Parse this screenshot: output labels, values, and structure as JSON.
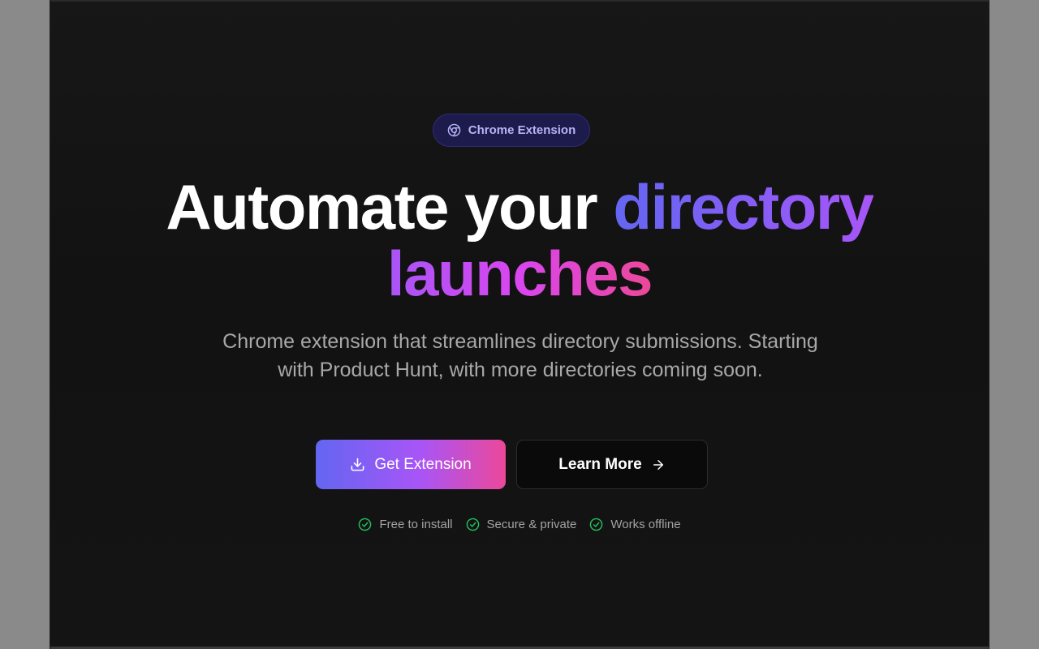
{
  "badge": {
    "label": "Chrome Extension",
    "icon": "chrome-icon"
  },
  "headline": {
    "part1": "Automate your ",
    "part2": "directory",
    "part3": "launches"
  },
  "subtitle": "Chrome extension that streamlines directory submissions. Starting with Product Hunt, with more directories coming soon.",
  "buttons": {
    "primary": {
      "label": "Get Extension",
      "icon": "download-icon"
    },
    "secondary": {
      "label": "Learn More",
      "icon": "arrow-right-icon"
    }
  },
  "features": [
    {
      "label": "Free to install",
      "icon": "check-circle-icon"
    },
    {
      "label": "Secure & private",
      "icon": "check-circle-icon"
    },
    {
      "label": "Works offline",
      "icon": "check-circle-icon"
    }
  ],
  "colors": {
    "background": "#141414",
    "accent_indigo": "#6366f1",
    "accent_purple": "#a855f7",
    "accent_pink": "#ec4899",
    "check_green": "#22c55e"
  }
}
